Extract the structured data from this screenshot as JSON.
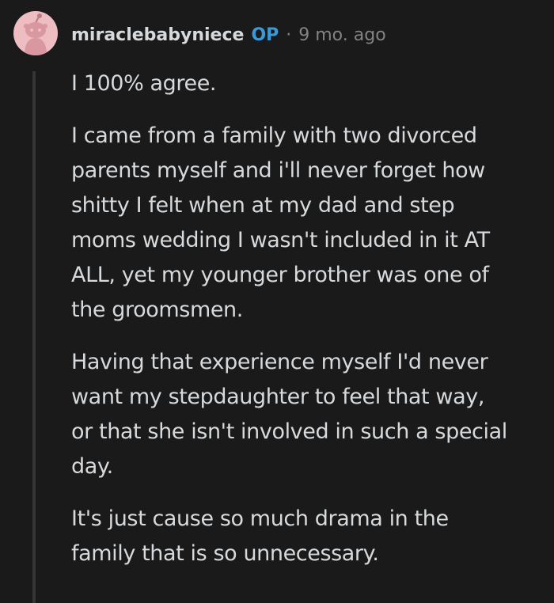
{
  "comment": {
    "username": "miraclebabyniece",
    "op_badge": "OP",
    "separator": "·",
    "timestamp": "9 mo. ago",
    "avatar_icon": "snoo-avatar-icon",
    "colors": {
      "background": "#1a1a1b",
      "text": "#d7dadc",
      "op_badge": "#3a9ad9",
      "meta": "#818384",
      "avatar_background": "#eebdc2",
      "thread_line": "#343536"
    },
    "paragraphs": [
      "I 100% agree.",
      "I came from a family with two divorced\nparents myself and i'll never forget how\nshitty I felt when at my dad and step\nmoms wedding I wasn't included in it AT\nALL, yet my younger brother was one of\nthe groomsmen.",
      "Having that experience myself I'd never\nwant my stepdaughter to feel that way,\nor that she isn't involved in such a special\nday.",
      "It's just cause so much drama in the\nfamily that is so unnecessary."
    ]
  }
}
